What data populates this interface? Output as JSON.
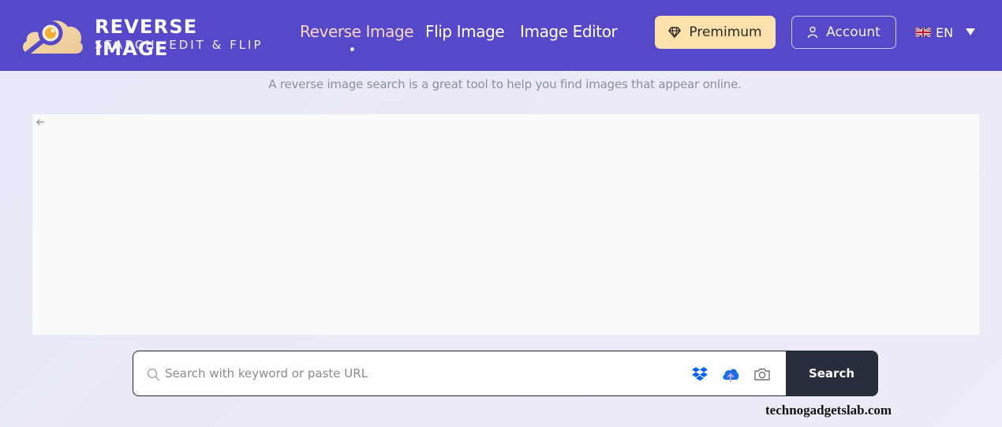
{
  "header": {
    "logo": {
      "title": "REVERSE IMAGE",
      "subtitle": "SEARCH, EDIT & FLIP",
      "icon": "cloud-magnifier-icon"
    },
    "nav": [
      {
        "label": "Reverse Image",
        "active": true
      },
      {
        "label": "Flip Image",
        "active": false
      },
      {
        "label": "Image Editor",
        "active": false
      }
    ],
    "premium_button": {
      "label": "Premimum",
      "icon": "diamond-icon"
    },
    "account_button": {
      "label": "Account",
      "icon": "user-icon"
    },
    "language": {
      "flag": "uk-flag-icon",
      "code": "EN",
      "caret": "caret-down-icon"
    }
  },
  "tagline": "A reverse image search is a great tool to help you find images that appear online.",
  "panel": {
    "back_icon": "arrow-left-icon"
  },
  "search": {
    "value": "",
    "placeholder": "Search with keyword or paste URL",
    "icons": [
      "search-icon",
      "dropbox-icon",
      "cloud-upload-icon",
      "camera-icon"
    ],
    "button_label": "Search"
  },
  "watermark": "technogadgetslab.com",
  "colors": {
    "header_bg": "#5549c9",
    "premium_bg": "#fde1ad",
    "nav_active": "#f8d4c9",
    "search_button_bg": "#272d3b",
    "dropbox_blue": "#0061fe",
    "upload_blue": "#1a6ee6"
  }
}
